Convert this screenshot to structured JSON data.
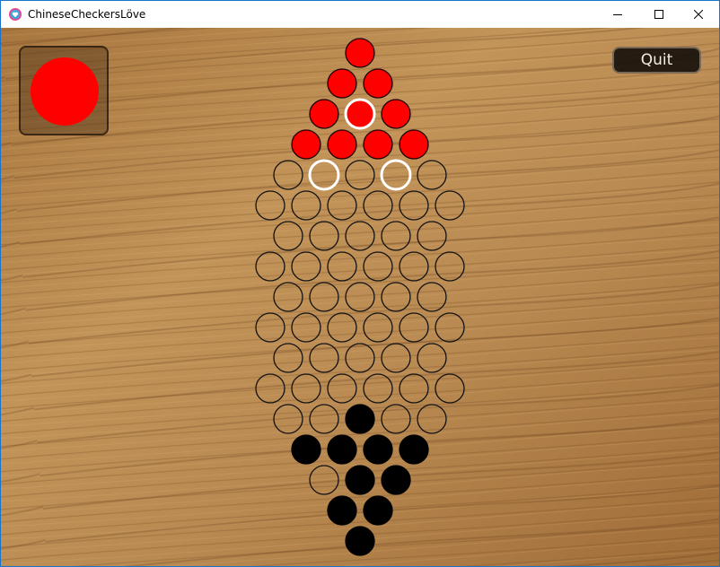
{
  "window": {
    "title": "ChineseCheckersLöve",
    "icon": "heart-app-icon",
    "controls": [
      "minimize",
      "maximize",
      "close"
    ]
  },
  "game": {
    "turn_indicator": {
      "player": "red",
      "color": "#ff0000"
    },
    "quit_label": "Quit",
    "colors": {
      "red": "#ff0000",
      "black": "#000000",
      "empty_outline": "#111111",
      "highlight_outline": "#ffffff",
      "wood": "#b98a52"
    },
    "board": {
      "rows": [
        [
          "R"
        ],
        [
          "R",
          "R"
        ],
        [
          "R",
          "Rh",
          "R"
        ],
        [
          "R",
          "R",
          "R",
          "R"
        ],
        [
          "E",
          "Eh",
          "E",
          "Eh",
          "E"
        ],
        [
          "E",
          "E",
          "E",
          "E",
          "E",
          "E"
        ],
        [
          "E",
          "E",
          "E",
          "E",
          "E"
        ],
        [
          "E",
          "E",
          "E",
          "E",
          "E",
          "E"
        ],
        [
          "E",
          "E",
          "E",
          "E",
          "E"
        ],
        [
          "E",
          "E",
          "E",
          "E",
          "E",
          "E"
        ],
        [
          "E",
          "E",
          "E",
          "E",
          "E"
        ],
        [
          "E",
          "E",
          "E",
          "E",
          "E",
          "E"
        ],
        [
          "E",
          "E",
          "B",
          "E",
          "E"
        ],
        [
          "B",
          "B",
          "B",
          "B"
        ],
        [
          "E",
          "B",
          "B"
        ],
        [
          "B",
          "B"
        ],
        [
          "B"
        ]
      ]
    }
  }
}
